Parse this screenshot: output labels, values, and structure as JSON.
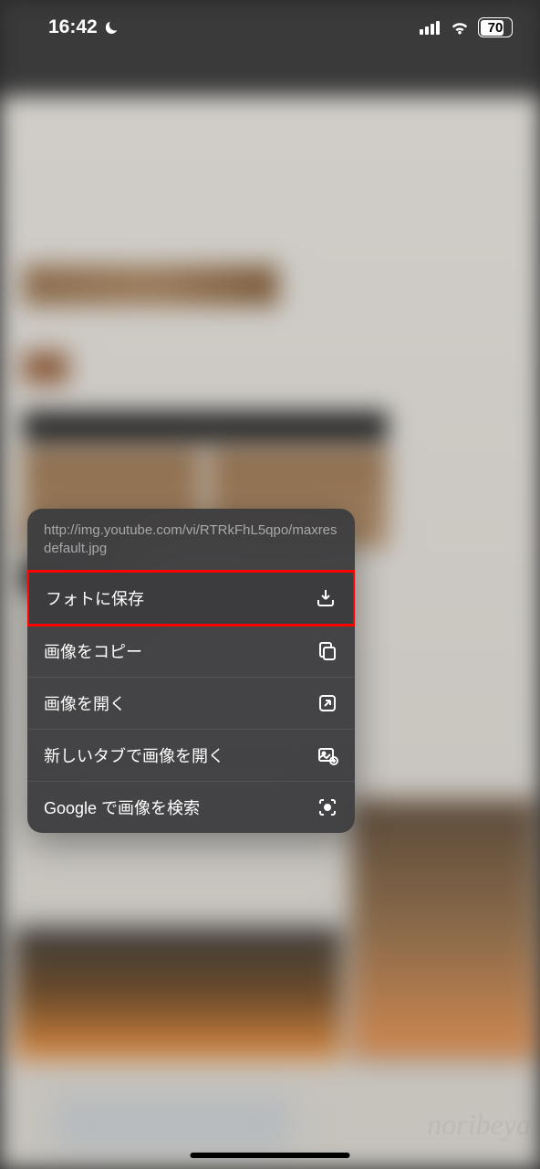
{
  "status_bar": {
    "time": "16:42",
    "battery_percent": "70"
  },
  "context_menu": {
    "url": "http://img.youtube.com/vi/RTRkFhL5qpo/maxresdefault.jpg",
    "items": [
      {
        "label": "フォトに保存",
        "icon": "download-icon",
        "highlighted": true
      },
      {
        "label": "画像をコピー",
        "icon": "copy-icon",
        "highlighted": false
      },
      {
        "label": "画像を開く",
        "icon": "open-icon",
        "highlighted": false
      },
      {
        "label": "新しいタブで画像を開く",
        "icon": "new-tab-image-icon",
        "highlighted": false
      },
      {
        "label": "Google で画像を検索",
        "icon": "lens-search-icon",
        "highlighted": false
      }
    ]
  },
  "watermark": "noribeya"
}
